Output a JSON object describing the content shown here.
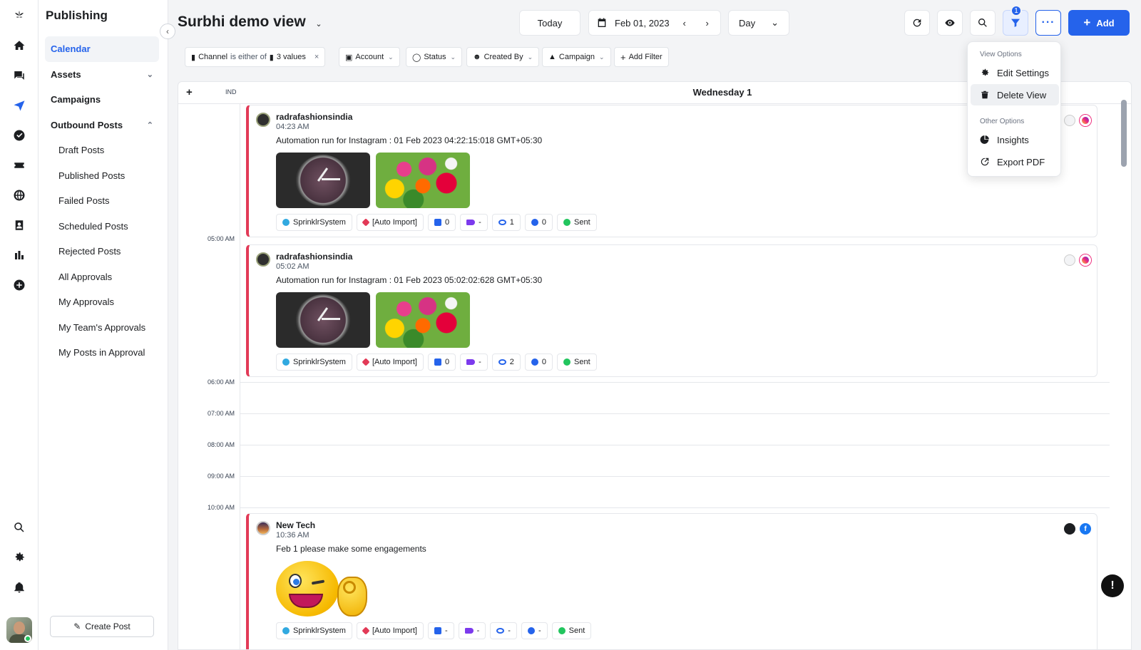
{
  "rail": {
    "icons": [
      "home-icon",
      "messages-icon",
      "publishing-icon",
      "tasks-icon",
      "ticket-icon",
      "globe-icon",
      "contacts-icon",
      "reports-icon",
      "add-icon",
      "search-icon",
      "settings-icon",
      "notifications-icon"
    ]
  },
  "sidebar": {
    "title": "Publishing",
    "items": [
      {
        "label": "Calendar"
      },
      {
        "label": "Assets"
      },
      {
        "label": "Campaigns"
      },
      {
        "label": "Outbound Posts"
      },
      {
        "label": "Draft Posts"
      },
      {
        "label": "Published Posts"
      },
      {
        "label": "Failed Posts"
      },
      {
        "label": "Scheduled Posts"
      },
      {
        "label": "Rejected Posts"
      },
      {
        "label": "All Approvals"
      },
      {
        "label": "My Approvals"
      },
      {
        "label": "My Team's Approvals"
      },
      {
        "label": "My Posts in Approval"
      }
    ],
    "create_post": "Create Post"
  },
  "header": {
    "title": "Surbhi demo view",
    "today": "Today",
    "date": "Feb 01, 2023",
    "view_mode": "Day",
    "filter_badge": "1",
    "add_label": "Add"
  },
  "filters": {
    "channel_field": "Channel",
    "channel_op": "is either of",
    "channel_values": "3 values",
    "account": "Account",
    "status": "Status",
    "created_by": "Created By",
    "campaign": "Campaign",
    "add_filter": "Add Filter"
  },
  "calendar": {
    "timezone": "IND",
    "day_label": "Wednesday 1",
    "times": [
      "05:00 AM",
      "06:00 AM",
      "07:00 AM",
      "08:00 AM",
      "09:00 AM",
      "10:00 AM"
    ]
  },
  "posts": [
    {
      "account": "radrafashionsindia",
      "time": "04:23 AM",
      "text": "Automation run for Instagram : 01 Feb 2023 04:22:15:018 GMT+05:30",
      "tags": {
        "user": "SprinklrSystem",
        "source": "[Auto Import]",
        "likes": "0",
        "tag": "-",
        "views": "1",
        "comments": "0",
        "status": "Sent"
      }
    },
    {
      "account": "radrafashionsindia",
      "time": "05:02 AM",
      "text": "Automation run for Instagram : 01 Feb 2023 05:02:02:628 GMT+05:30",
      "tags": {
        "user": "SprinklrSystem",
        "source": "[Auto Import]",
        "likes": "0",
        "tag": "-",
        "views": "2",
        "comments": "0",
        "status": "Sent"
      }
    },
    {
      "account": "New Tech",
      "time": "10:36 AM",
      "text": "Feb 1 please make some engagements",
      "tags": {
        "user": "SprinklrSystem",
        "source": "[Auto Import]",
        "likes": "-",
        "tag": "-",
        "views": "-",
        "comments": "-",
        "status": "Sent"
      }
    }
  ],
  "menu": {
    "view_options": "View Options",
    "edit_settings": "Edit Settings",
    "delete_view": "Delete View",
    "other_options": "Other Options",
    "insights": "Insights",
    "export_pdf": "Export PDF"
  },
  "colors": {
    "accent": "#2563eb",
    "post_border": "#e23a57",
    "sent": "#22c55e"
  }
}
